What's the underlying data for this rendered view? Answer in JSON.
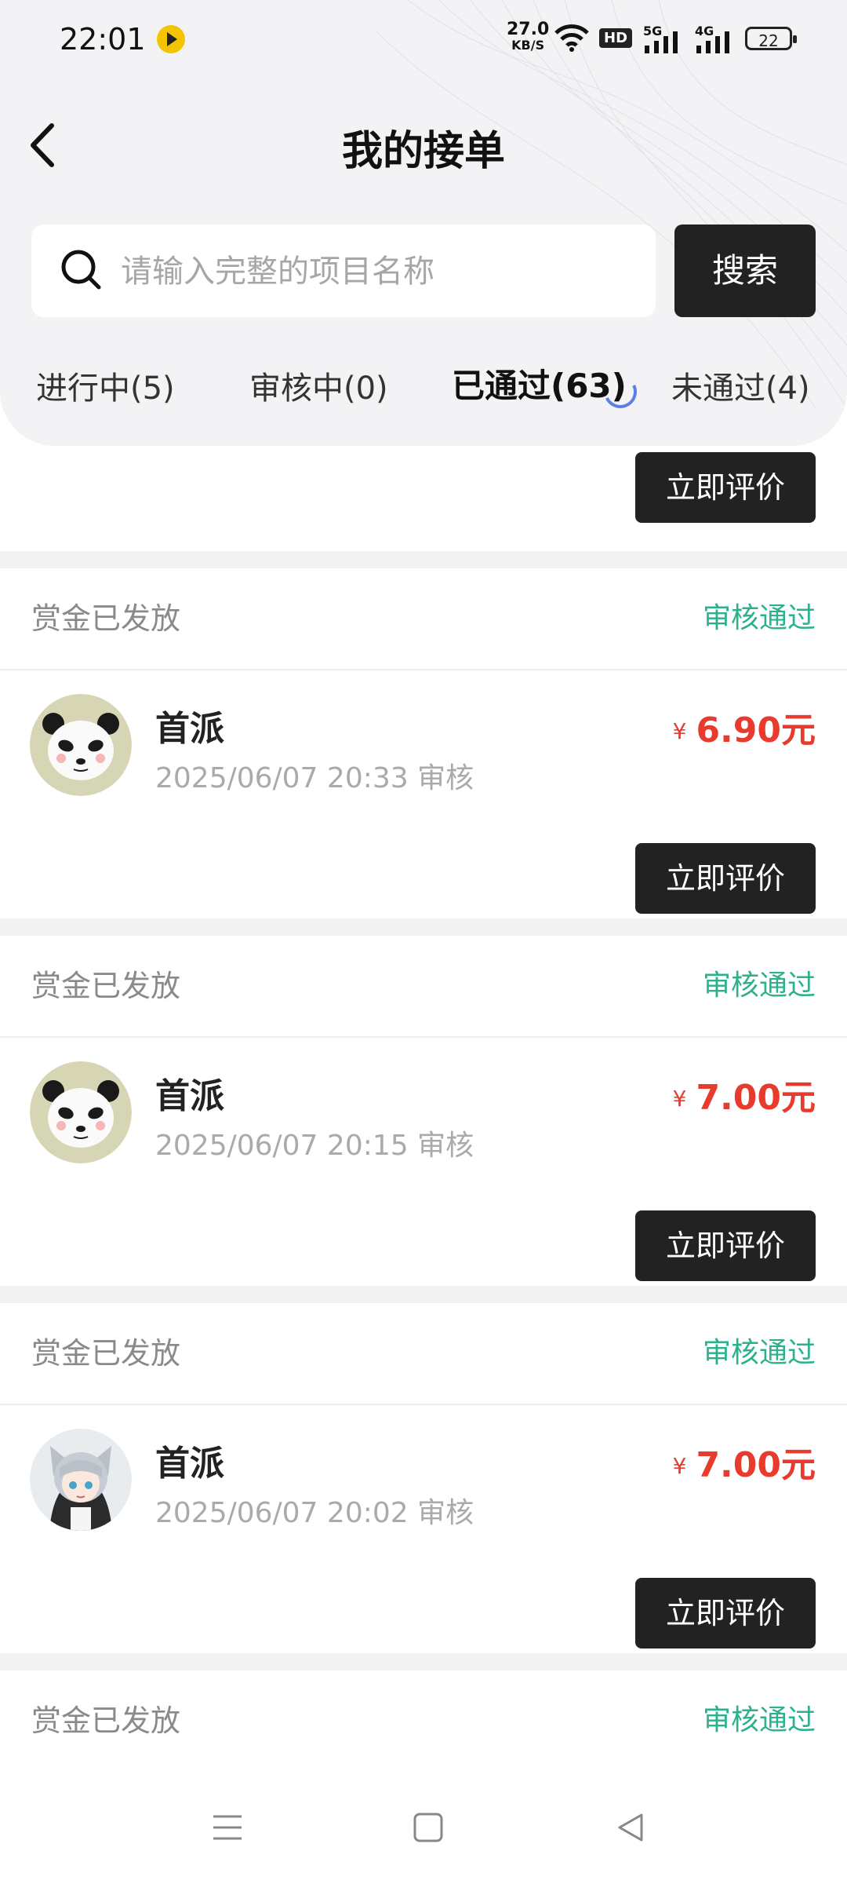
{
  "status_bar": {
    "time": "22:01",
    "net_speed": "27.0",
    "net_unit": "KB/S",
    "hd_label": "HD",
    "sig1_label": "5G",
    "sig2_label": "4G",
    "battery": "22"
  },
  "header": {
    "title": "我的接单"
  },
  "search": {
    "placeholder": "请输入完整的项目名称",
    "button_label": "搜索"
  },
  "tabs": [
    {
      "label": "进行中(5)",
      "active": false
    },
    {
      "label": "审核中(0)",
      "active": false
    },
    {
      "label": "已通过(63)",
      "active": true
    },
    {
      "label": "未通过(4)",
      "active": false
    }
  ],
  "top_partial": {
    "button_label": "立即评价"
  },
  "cards": [
    {
      "status_left": "赏金已发放",
      "status_right": "审核通过",
      "name": "首派",
      "date": "2025/06/07 20:33 审核",
      "currency": "¥",
      "amount": "6.90元",
      "button_label": "立即评价",
      "avatar": "panda-avatar"
    },
    {
      "status_left": "赏金已发放",
      "status_right": "审核通过",
      "name": "首派",
      "date": "2025/06/07 20:15 审核",
      "currency": "¥",
      "amount": "7.00元",
      "button_label": "立即评价",
      "avatar": "panda-avatar"
    },
    {
      "status_left": "赏金已发放",
      "status_right": "审核通过",
      "name": "首派",
      "date": "2025/06/07 20:02 审核",
      "currency": "¥",
      "amount": "7.00元",
      "button_label": "立即评价",
      "avatar": "anime-girl-avatar"
    }
  ],
  "bottom_partial": {
    "status_left": "赏金已发放",
    "status_right": "审核通过"
  },
  "colors": {
    "accent_green": "#2bb18b",
    "price_red": "#e83a2d",
    "button_dark": "#222222"
  },
  "bottom_nav": [
    "menu-icon",
    "home-square-icon",
    "back-triangle-icon"
  ]
}
